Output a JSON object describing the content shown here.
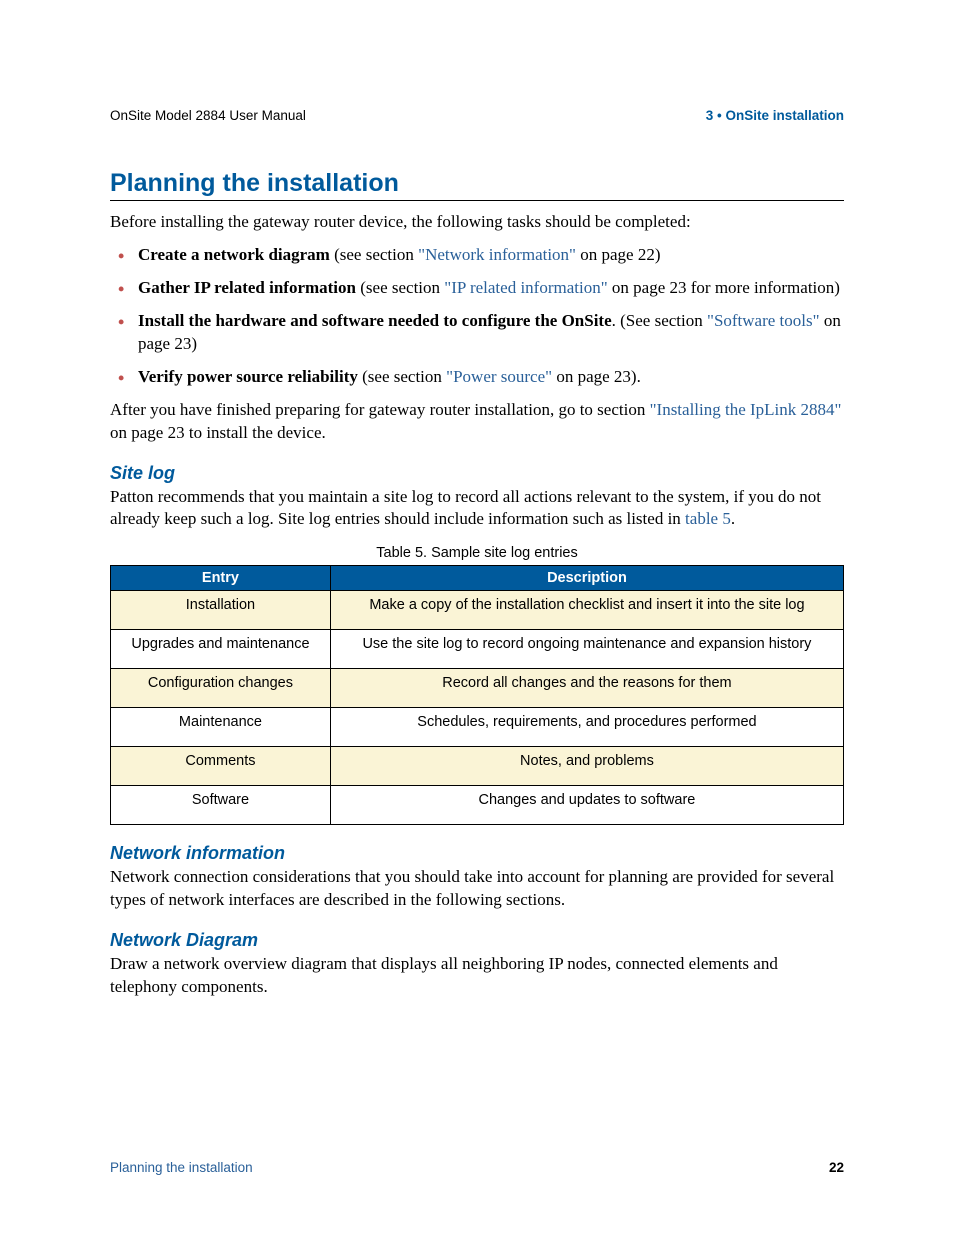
{
  "header": {
    "left": "OnSite Model 2884 User Manual",
    "right": "3 • OnSite installation"
  },
  "title": "Planning the installation",
  "intro": "Before installing the gateway router device, the following tasks should be completed:",
  "bullets": {
    "b1_bold": "Create a network diagram",
    "b1_a": " (see section ",
    "b1_link": "\"Network information\"",
    "b1_b": " on page 22)",
    "b2_bold": "Gather IP related information",
    "b2_a": " (see section ",
    "b2_link": "\"IP related information\"",
    "b2_b": " on page 23 for more information)",
    "b3_bold": "Install the hardware and software needed to configure the OnSite",
    "b3_a": ". (See section ",
    "b3_link": "\"Software tools\"",
    "b3_b": " on page 23)",
    "b4_bold": "Verify power source reliability",
    "b4_a": " (see section ",
    "b4_link": "\"Power source\"",
    "b4_b": " on page 23)."
  },
  "after_a": "After you have finished preparing for gateway router installation, go to section ",
  "after_link": "\"Installing the IpLink 2884\"",
  "after_b": " on page 23 to install the device.",
  "sitelog": {
    "heading": "Site log",
    "para_a": "Patton recommends that you maintain a site log to record all actions relevant to the system, if you do not already keep such a log. Site log entries should include information such as listed in ",
    "para_link": "table 5",
    "para_b": "."
  },
  "table_caption": "Table 5. Sample site log entries",
  "table": {
    "h1": "Entry",
    "h2": "Description",
    "rows": [
      {
        "entry": "Installation",
        "desc": "Make a copy of the installation checklist and insert it into the site log"
      },
      {
        "entry": "Upgrades and maintenance",
        "desc": "Use the site log to record ongoing maintenance and expansion history"
      },
      {
        "entry": "Configuration changes",
        "desc": "Record all changes and the reasons for them"
      },
      {
        "entry": "Maintenance",
        "desc": "Schedules, requirements, and procedures performed"
      },
      {
        "entry": "Comments",
        "desc": "Notes, and problems"
      },
      {
        "entry": "Software",
        "desc": "Changes and updates to software"
      }
    ]
  },
  "netinfo": {
    "heading": "Network information",
    "para": "Network connection considerations that you should take into account for planning are provided for several types of network interfaces are described in the following sections."
  },
  "netdiag": {
    "heading": "Network Diagram",
    "para": "Draw a network overview diagram that displays all neighboring IP nodes, connected elements and telephony components."
  },
  "footer": {
    "left": "Planning the installation",
    "right": "22"
  }
}
